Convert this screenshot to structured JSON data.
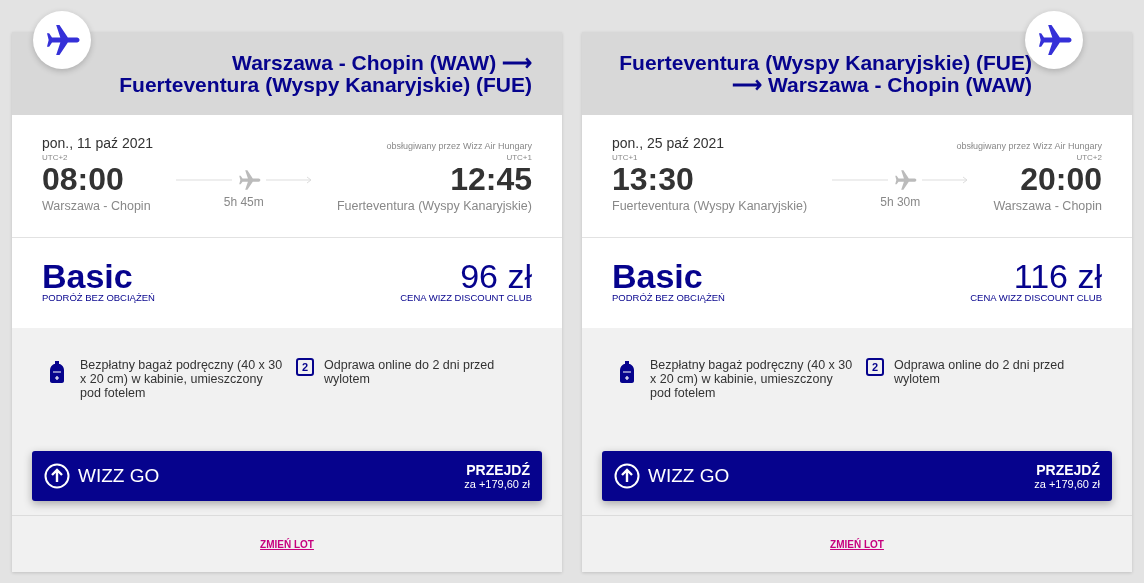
{
  "cards": [
    {
      "kind": "outbound",
      "title": [
        "Warszawa - Chopin (WAW) ⟶",
        "Fuerteventura (Wyspy Kanaryjskie) (FUE)"
      ],
      "date": "pon., 11 paź 2021",
      "operator": "obsługiwany przez Wizz Air Hungary",
      "departure": {
        "utc": "UTC+2",
        "time": "08:00",
        "airport": "Warszawa - Chopin"
      },
      "duration": "5h 45m",
      "arrival": {
        "utc": "UTC+1",
        "time": "12:45",
        "airport": "Fuerteventura (Wyspy Kanaryjskie)"
      },
      "fare": {
        "name": "Basic",
        "subtitle": "PODRÓŻ BEZ OBCIĄŻEŃ",
        "price": "96 zł",
        "price_note": "CENA WIZZ DISCOUNT CLUB"
      },
      "benefits": [
        {
          "kind": "bag",
          "text": "Bezpłatny bagaż podręczny (40 x 30 x 20 cm) w kabinie, umieszczony pod fotelem"
        },
        {
          "kind": "calendar",
          "icon_text": "2",
          "text": "Odprawa online do 2 dni przed wylotem"
        }
      ],
      "upgrade": {
        "label": "WIZZ GO",
        "action": "PRZEJDŹ",
        "price": "za +179,60 zł"
      },
      "change_link": "ZMIEŃ LOT"
    },
    {
      "kind": "return",
      "title": [
        "Fuerteventura (Wyspy Kanaryjskie) (FUE)",
        "⟶ Warszawa - Chopin (WAW)"
      ],
      "date": "pon., 25 paź 2021",
      "operator": "obsługiwany przez Wizz Air Hungary",
      "departure": {
        "utc": "UTC+1",
        "time": "13:30",
        "airport": "Fuerteventura (Wyspy Kanaryjskie)"
      },
      "duration": "5h 30m",
      "arrival": {
        "utc": "UTC+2",
        "time": "20:00",
        "airport": "Warszawa - Chopin"
      },
      "fare": {
        "name": "Basic",
        "subtitle": "PODRÓŻ BEZ OBCIĄŻEŃ",
        "price": "116 zł",
        "price_note": "CENA WIZZ DISCOUNT CLUB"
      },
      "benefits": [
        {
          "kind": "bag",
          "text": "Bezpłatny bagaż podręczny (40 x 30 x 20 cm) w kabinie, umieszczony pod fotelem"
        },
        {
          "kind": "calendar",
          "icon_text": "2",
          "text": "Odprawa online do 2 dni przed wylotem"
        }
      ],
      "upgrade": {
        "label": "WIZZ GO",
        "action": "PRZEJDŹ",
        "price": "za +179,60 zł"
      },
      "change_link": "ZMIEŃ LOT"
    }
  ]
}
